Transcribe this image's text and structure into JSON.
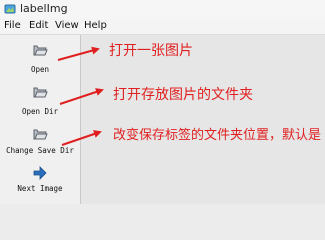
{
  "window": {
    "title": "labelImg"
  },
  "menubar": {
    "items": [
      "File",
      "Edit",
      "View",
      "Help"
    ]
  },
  "toolbar": {
    "tools": [
      {
        "label": "Open",
        "icon": "folder-open-icon"
      },
      {
        "label": "Open Dir",
        "icon": "folder-open-icon"
      },
      {
        "label": "Change Save Dir",
        "icon": "folder-open-icon"
      },
      {
        "label": "Next Image",
        "icon": "arrow-right-icon"
      }
    ]
  },
  "annotations": [
    "打开一张图片",
    "打开存放图片的文件夹",
    "改变保存标签的文件夹位置，默认是"
  ],
  "colors": {
    "annotation": "#e02020",
    "next_arrow": "#2a6fbe"
  }
}
